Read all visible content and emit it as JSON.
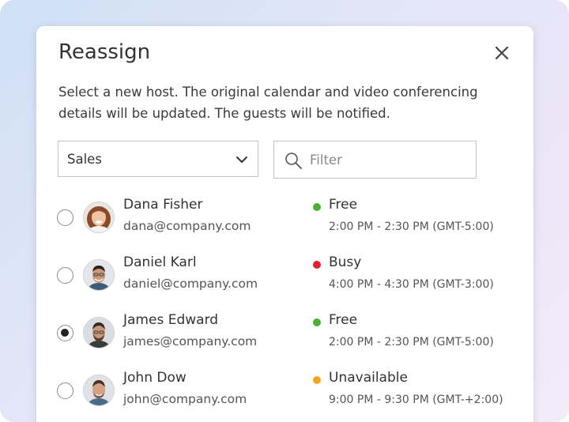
{
  "dialog": {
    "title": "Reassign",
    "description": "Select a new host. The original calendar and video conferencing details will be updated. The guests will be notified."
  },
  "team_select": {
    "selected": "Sales"
  },
  "filter": {
    "placeholder": "Filter"
  },
  "status_colors": {
    "free": "#4caf37",
    "busy": "#e0202f",
    "unavailable": "#f5a524"
  },
  "hosts": [
    {
      "name": "Dana Fisher",
      "email": "dana@company.com",
      "status": "Free",
      "time": "2:00 PM - 2:30 PM (GMT-5:00)",
      "selected": false
    },
    {
      "name": "Daniel Karl",
      "email": "daniel@company.com",
      "status": "Busy",
      "time": "4:00 PM - 4:30 PM (GMT-3:00)",
      "selected": false
    },
    {
      "name": "James Edward",
      "email": "james@company.com",
      "status": "Free",
      "time": "2:00 PM - 2:30 PM (GMT-5:00)",
      "selected": true
    },
    {
      "name": "John Dow",
      "email": "john@company.com",
      "status": "Unavailable",
      "time": "9:00 PM - 9:30 PM (GMT-+2:00)",
      "selected": false
    }
  ]
}
